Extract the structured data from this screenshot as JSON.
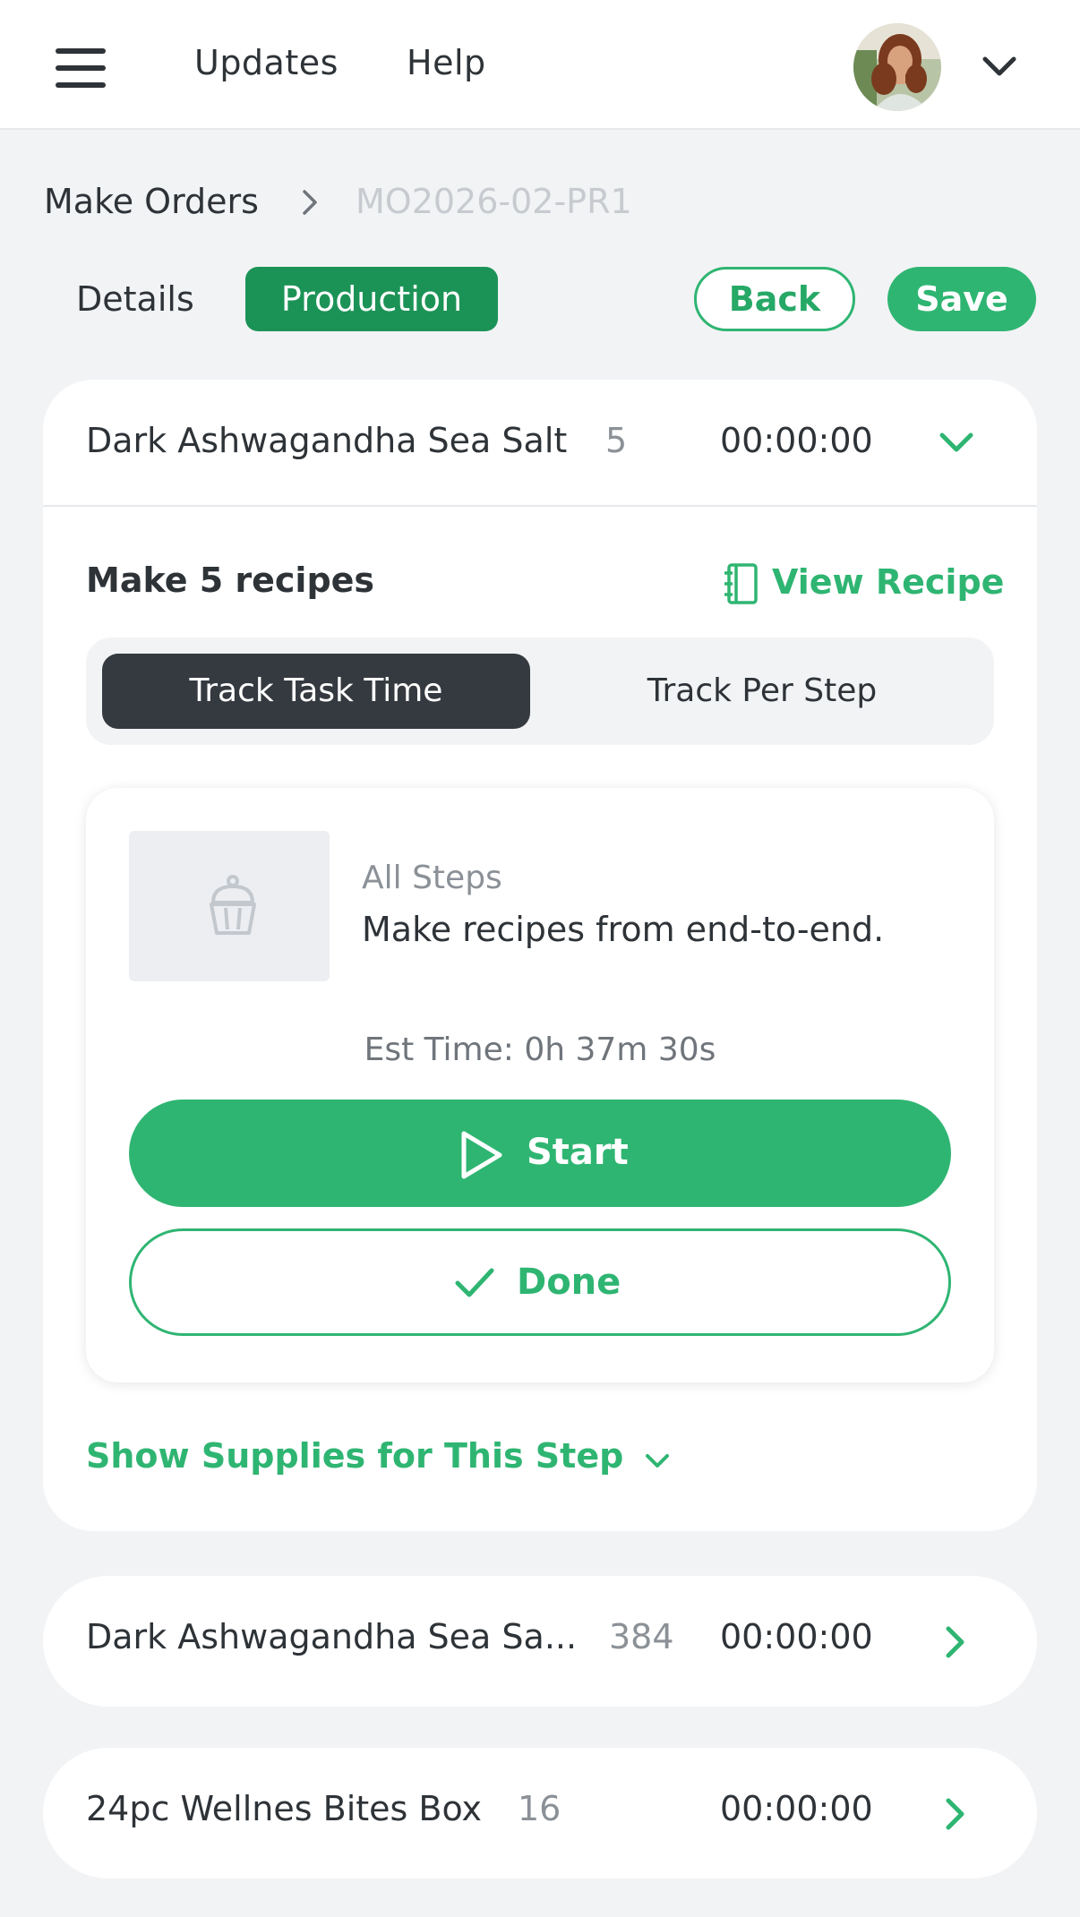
{
  "nav": {
    "updates": "Updates",
    "help": "Help"
  },
  "breadcrumb": {
    "root": "Make Orders",
    "current": "MO2026-02-PR1"
  },
  "tabs": {
    "details": "Details",
    "production": "Production"
  },
  "actions": {
    "back": "Back",
    "save": "Save"
  },
  "colors": {
    "accent": "#2fb572",
    "accent_dark": "#1c9356",
    "toggle_active": "#353a40"
  },
  "main_item": {
    "name": "Dark Ashwagandha Sea Salt",
    "qty": "5",
    "time": "00:00:00",
    "make_title": "Make 5 recipes",
    "view_recipe": "View Recipe",
    "toggle": {
      "active": "Track Task Time",
      "inactive": "Track Per Step"
    },
    "step": {
      "label": "All Steps",
      "description": "Make recipes from end-to-end.",
      "est_time": "Est Time: 0h 37m 30s",
      "start": "Start",
      "done": "Done",
      "icon": "cupcake-icon"
    },
    "show_supplies": "Show Supplies for This Step"
  },
  "items": [
    {
      "name": "Dark Ashwagandha Sea Sa...",
      "qty": "384",
      "time": "00:00:00"
    },
    {
      "name": "24pc Wellnes Bites Box",
      "qty": "16",
      "time": "00:00:00"
    }
  ]
}
